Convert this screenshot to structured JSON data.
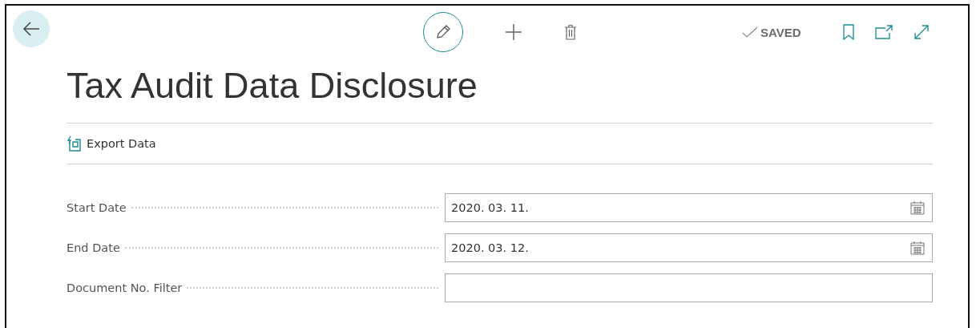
{
  "toolbar": {
    "status": "SAVED"
  },
  "title": "Tax Audit Data Disclosure",
  "actions": [
    {
      "label": "Export Data"
    }
  ],
  "fields": [
    {
      "label": "Start Date",
      "kind": "date",
      "value": "2020. 03. 11."
    },
    {
      "label": "End Date",
      "kind": "date",
      "value": "2020. 03. 12."
    },
    {
      "label": "Document No. Filter",
      "kind": "text"
    }
  ]
}
